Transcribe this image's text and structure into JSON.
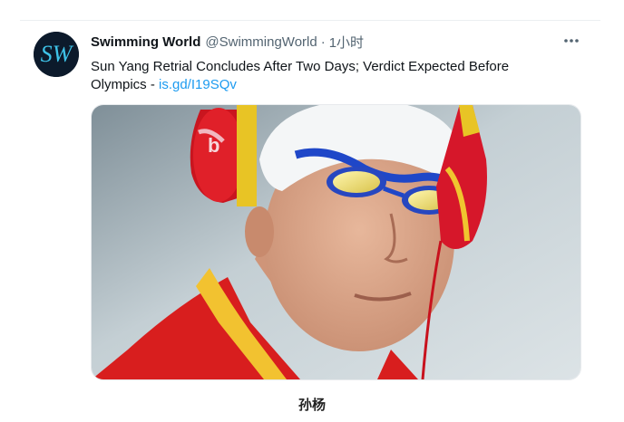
{
  "tweet": {
    "display_name": "Swimming World",
    "handle": "@SwimmingWorld",
    "separator": "·",
    "time": "1小时",
    "text": "Sun Yang Retrial Concludes After Two Days; Verdict Expected Before Olympics - ",
    "link_text": "is.gd/I19SQv",
    "avatar_letters": "SW",
    "more_icon": "more-horizontal-icon"
  },
  "caption": "孙杨",
  "colors": {
    "link": "#1d9bf0",
    "text": "#0f1419",
    "muted": "#536471",
    "avatar_bg": "#0d1b2a"
  }
}
